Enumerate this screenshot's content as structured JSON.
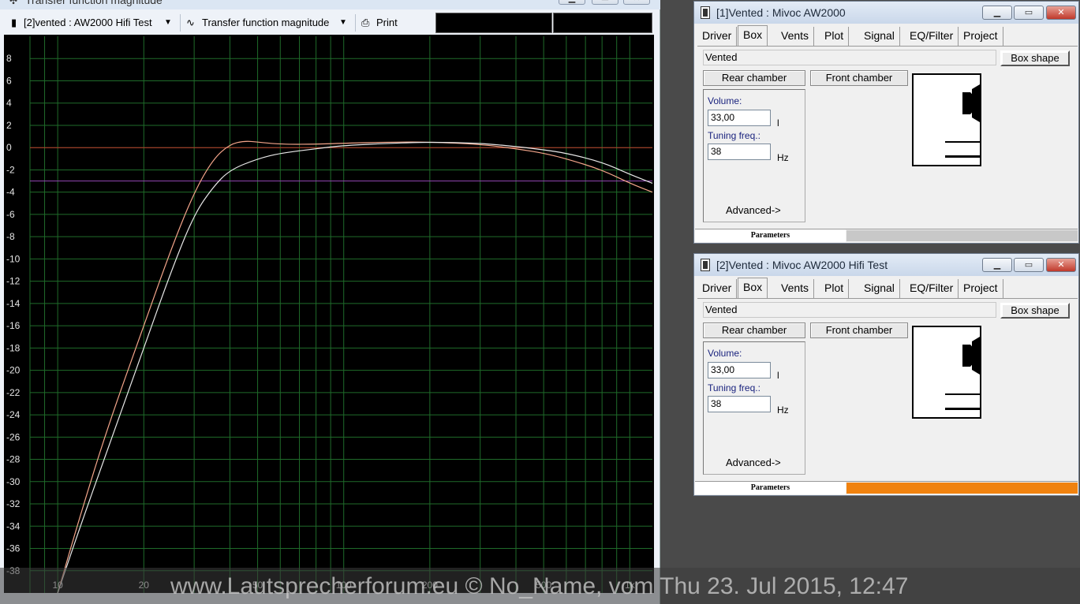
{
  "plot_window": {
    "title": "Transfer function magnitude",
    "toolbar": {
      "curve_select": "[2]vented : AW2000 Hifi Test",
      "plot_select": "Transfer function magnitude",
      "print_label": "Print"
    }
  },
  "chart_data": {
    "type": "line",
    "x_scale": "log",
    "xlim": [
      8,
      1200
    ],
    "ylim": [
      -40,
      10
    ],
    "x_ticks": [
      {
        "value": 10,
        "label": "10"
      },
      {
        "value": 20,
        "label": "20"
      },
      {
        "value": 50,
        "label": "50"
      },
      {
        "value": 100,
        "label": "100"
      },
      {
        "value": 200,
        "label": "200"
      },
      {
        "value": 500,
        "label": "500"
      },
      {
        "value": 1000,
        "label": "1k"
      }
    ],
    "y_ticks": [
      8,
      6,
      4,
      2,
      0,
      -2,
      -4,
      -6,
      -8,
      -10,
      -12,
      -14,
      -16,
      -18,
      -20,
      -22,
      -24,
      -26,
      -28,
      -30,
      -32,
      -34,
      -36,
      -38
    ],
    "grid": true,
    "reference_lines": [
      {
        "y": 0,
        "color": "#c0392b"
      },
      {
        "y": -3,
        "color": "#8e44ad"
      }
    ],
    "series": [
      {
        "color": "#f4a58a",
        "points": [
          [
            10,
            -40
          ],
          [
            12,
            -33
          ],
          [
            15,
            -25
          ],
          [
            20,
            -16
          ],
          [
            25,
            -9
          ],
          [
            30,
            -4
          ],
          [
            35,
            -1
          ],
          [
            40,
            0.3
          ],
          [
            45,
            0.6
          ],
          [
            50,
            0.5
          ],
          [
            60,
            0.3
          ],
          [
            80,
            0.3
          ],
          [
            100,
            0.4
          ],
          [
            150,
            0.5
          ],
          [
            200,
            0.5
          ],
          [
            300,
            0.3
          ],
          [
            400,
            -0.1
          ],
          [
            500,
            -0.5
          ],
          [
            600,
            -1
          ],
          [
            800,
            -2
          ],
          [
            1000,
            -3.2
          ],
          [
            1200,
            -4
          ]
        ]
      },
      {
        "color": "#e8e8e8",
        "points": [
          [
            10,
            -40
          ],
          [
            12,
            -34
          ],
          [
            15,
            -27
          ],
          [
            20,
            -18
          ],
          [
            25,
            -11
          ],
          [
            30,
            -6
          ],
          [
            35,
            -3.5
          ],
          [
            40,
            -2
          ],
          [
            50,
            -1
          ],
          [
            60,
            -0.5
          ],
          [
            80,
            -0.1
          ],
          [
            100,
            0.2
          ],
          [
            150,
            0.4
          ],
          [
            200,
            0.5
          ],
          [
            300,
            0.4
          ],
          [
            400,
            0.1
          ],
          [
            500,
            -0.2
          ],
          [
            600,
            -0.5
          ],
          [
            800,
            -1.3
          ],
          [
            1000,
            -2.4
          ],
          [
            1200,
            -3.2
          ]
        ]
      }
    ]
  },
  "windows": [
    {
      "title": "[1]Vented : Mivoc AW2000",
      "tabs": [
        "Driver",
        "Box",
        "Vents",
        "Plot",
        "Signal",
        "EQ/Filter",
        "Project"
      ],
      "active_tab": "Box",
      "box_type": "Vented",
      "box_shape_label": "Box shape",
      "rear_chamber_label": "Rear chamber",
      "front_chamber_label": "Front chamber",
      "volume_label": "Volume:",
      "volume_value": "33,00",
      "volume_unit": "l",
      "tuning_label": "Tuning freq.:",
      "tuning_value": "38",
      "tuning_unit": "Hz",
      "advanced_label": "Advanced->",
      "status_label": "Parameters",
      "status_color": "#c8c8c8"
    },
    {
      "title": "[2]Vented : Mivoc AW2000 Hifi Test",
      "tabs": [
        "Driver",
        "Box",
        "Vents",
        "Plot",
        "Signal",
        "EQ/Filter",
        "Project"
      ],
      "active_tab": "Box",
      "box_type": "Vented",
      "box_shape_label": "Box shape",
      "rear_chamber_label": "Rear chamber",
      "front_chamber_label": "Front chamber",
      "volume_label": "Volume:",
      "volume_value": "33,00",
      "volume_unit": "l",
      "tuning_label": "Tuning freq.:",
      "tuning_value": "38",
      "tuning_unit": "Hz",
      "advanced_label": "Advanced->",
      "status_label": "Parameters",
      "status_color": "#f0820f"
    }
  ],
  "watermark": "www.Lautsprecherforum.eu © No_Name, vom Thu 23. Jul 2015, 12:47"
}
